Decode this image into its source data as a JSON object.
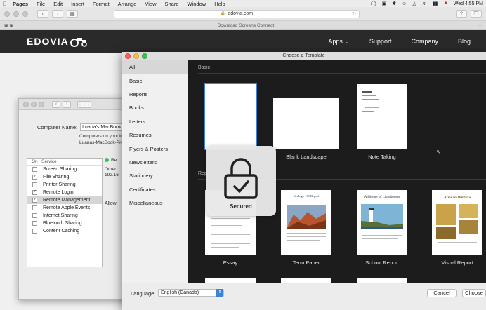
{
  "menubar": {
    "app": "Pages",
    "items": [
      "File",
      "Edit",
      "Insert",
      "Format",
      "Arrange",
      "View",
      "Share",
      "Window",
      "Help"
    ],
    "clock": "Wed 4:55 PM"
  },
  "safari": {
    "url": "edovia.com",
    "tab_title": "Download Screens Connect"
  },
  "site": {
    "logo": "EDOVIA",
    "nav": [
      "Apps",
      "Support",
      "Company",
      "Blog"
    ]
  },
  "sharing": {
    "computer_name_label": "Computer Name:",
    "computer_name_value": "Luana's MacBook",
    "desc_line1": "Computers on your lo",
    "desc_line2": "Luanas-MacBook-Pro",
    "col_on": "On",
    "col_service": "Service",
    "services": [
      {
        "name": "Screen Sharing",
        "on": false,
        "selected": false
      },
      {
        "name": "File Sharing",
        "on": true,
        "selected": false
      },
      {
        "name": "Printer Sharing",
        "on": false,
        "selected": false
      },
      {
        "name": "Remote Login",
        "on": true,
        "selected": false
      },
      {
        "name": "Remote Management",
        "on": true,
        "selected": true
      },
      {
        "name": "Remote Apple Events",
        "on": false,
        "selected": false
      },
      {
        "name": "Internet Sharing",
        "on": false,
        "selected": false
      },
      {
        "name": "Bluetooth Sharing",
        "on": false,
        "selected": false
      },
      {
        "name": "Content Caching",
        "on": false,
        "selected": false
      }
    ],
    "status_prefix": "Re",
    "other_text": "Other",
    "ip_text": "192.16",
    "allow_text": "Allow"
  },
  "chooser": {
    "title": "Choose a Template",
    "categories": [
      "All",
      "Basic",
      "Reports",
      "Books",
      "Letters",
      "Resumes",
      "Flyers & Posters",
      "Newsletters",
      "Stationery",
      "Certificates",
      "Miscellaneous"
    ],
    "selected_category": "All",
    "section_basic": "Basic",
    "section_reports": "Rep",
    "basic_templates": [
      "",
      "Blank Landscape",
      "Note Taking"
    ],
    "report_templates": [
      "Essay",
      "Term Paper",
      "School Report",
      "Visual Report"
    ],
    "thumb_texts": {
      "term_paper_title": "Geology 101 Report",
      "school_report_title": "A History of Lighthouses",
      "visual_report_title": "African Wildlife"
    },
    "language_label": "Language:",
    "language_value": "English (Canada)",
    "cancel": "Cancel",
    "choose": "Choose"
  },
  "overlay": {
    "label": "Secured"
  }
}
